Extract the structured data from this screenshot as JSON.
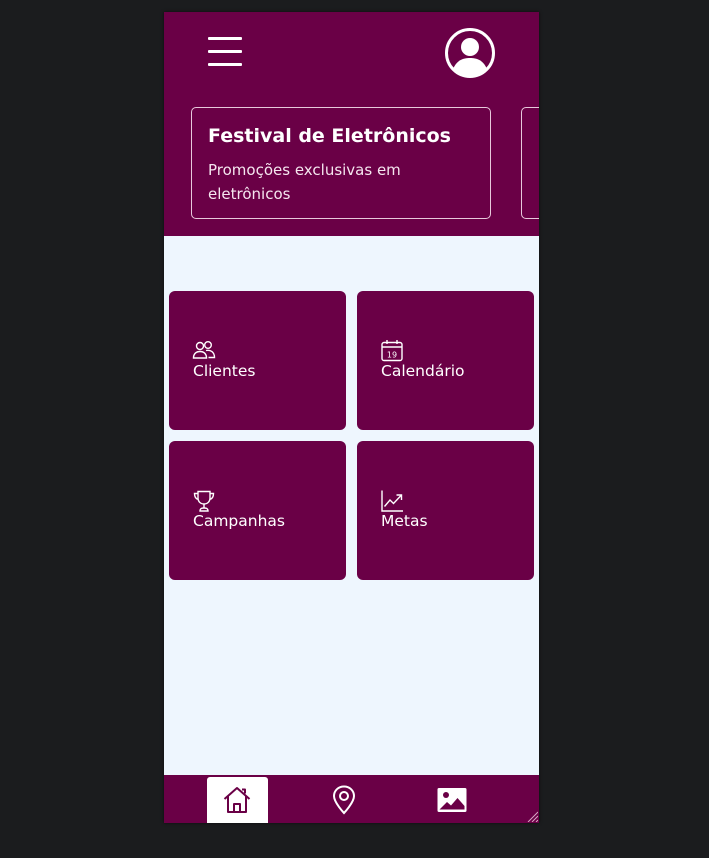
{
  "colors": {
    "brand": "#6a0046",
    "background": "#eef6fe",
    "text_on_brand": "#ffffff"
  },
  "header": {
    "menu_icon": "hamburger-menu-icon",
    "profile_icon": "user-circle-icon"
  },
  "banners": [
    {
      "title": "Festival de Eletrônicos",
      "description": "Promoções exclusivas em eletrônicos"
    }
  ],
  "tiles": [
    {
      "label": "Clientes",
      "icon": "users-icon"
    },
    {
      "label": "Calendário",
      "icon": "calendar-icon",
      "icon_text": "19"
    },
    {
      "label": "Campanhas",
      "icon": "trophy-icon"
    },
    {
      "label": "Metas",
      "icon": "chart-line-icon"
    }
  ],
  "bottom_nav": {
    "items": [
      {
        "icon": "home-icon",
        "active": true
      },
      {
        "icon": "map-pin-icon",
        "active": false
      },
      {
        "icon": "image-icon",
        "active": false
      }
    ]
  }
}
